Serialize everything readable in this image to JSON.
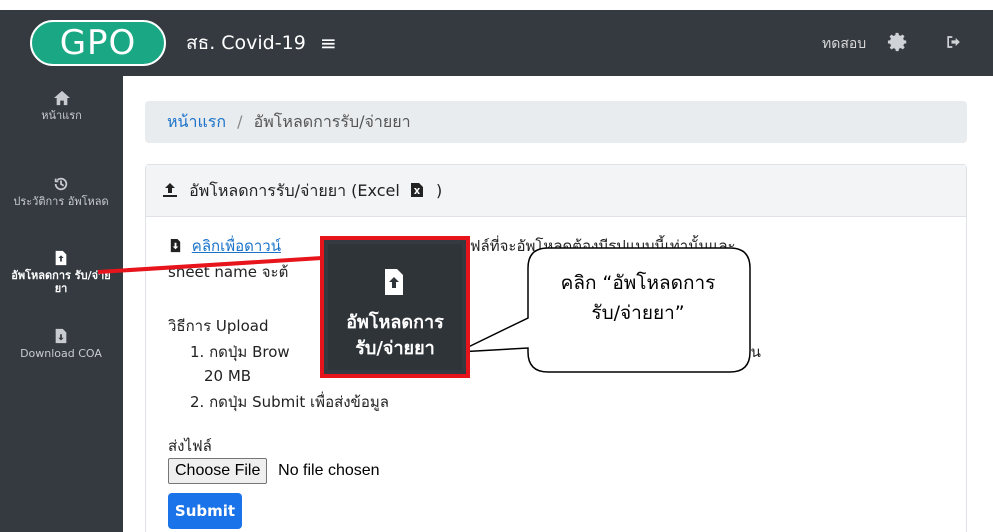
{
  "navbar": {
    "logo": "GPO",
    "title": "สธ. Covid-19",
    "menu_icon": "≡",
    "user": "ทดสอบ",
    "settings_icon": "gear-icon",
    "logout_icon": "logout-icon"
  },
  "sidebar": {
    "items": [
      {
        "label": "หน้าแรก",
        "icon": "home-icon"
      },
      {
        "label": "ประวัติการ อัพโหลด",
        "icon": "history-icon"
      },
      {
        "label": "อัพโหลดการ รับ/จ่ายยา",
        "icon": "file-upload-icon",
        "active": true
      },
      {
        "label": "Download COA",
        "icon": "file-download-icon"
      }
    ]
  },
  "breadcrumb": {
    "home": "หน้าแรก",
    "separator": "/",
    "current": "อัพโหลดการรับ/จ่ายยา"
  },
  "card": {
    "header": "อัพโหลดการรับ/จ่ายยา (Excel",
    "line1_link": "คลิกเพื่อดาวน์",
    "line1_rest": "(ไฟล์ที่จะอัพโหลดต้องมีรูปแบบนี้เท่านั้นและ",
    "line2": "sheet name จะต้",
    "howto": "วิธีการ Upload",
    "step1_start": "1. กดปุ่ม Brow",
    "step1_end": "ดของไฟล์ต้องไม่เกิน",
    "step1_cont": "20 MB",
    "step2": "2. กดปุ่ม Submit เพื่อส่งข้อมูล",
    "send_label": "ส่งไฟล์",
    "choose_file": "Choose File",
    "no_file": "No file chosen",
    "submit": "Submit"
  },
  "callout": {
    "zoom_label_line1": "อัพโหลดการ",
    "zoom_label_line2": "รับ/จ่ายยา",
    "bubble_line1": "คลิก “อัพโหลดการ",
    "bubble_line2": "รับ/จ่ายยา”"
  },
  "colors": {
    "sidebar": "#343a40",
    "accent": "#1a73e8",
    "highlight": "#e8141c",
    "logo": "#1aa884"
  }
}
